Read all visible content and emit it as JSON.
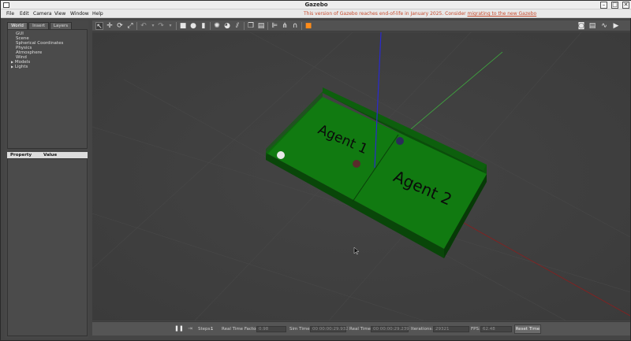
{
  "window": {
    "title": "Gazebo",
    "minimize_glyph": "–",
    "maximize_glyph": "□",
    "close_glyph": "✕"
  },
  "menubar": {
    "items": [
      "File",
      "Edit",
      "Camera",
      "View",
      "Window",
      "Help"
    ],
    "notice_prefix": "This version of Gazebo reaches end-of-life in January 2025. Consider",
    "notice_link": "migrating to the new Gazebo"
  },
  "left_panel": {
    "tabs": [
      "World",
      "Insert",
      "Layers"
    ],
    "active_tab": "World",
    "tree": [
      {
        "label": "GUI",
        "expandable": false
      },
      {
        "label": "Scene",
        "expandable": false
      },
      {
        "label": "Spherical Coordinates",
        "expandable": false
      },
      {
        "label": "Physics",
        "expandable": false
      },
      {
        "label": "Atmosphere",
        "expandable": false
      },
      {
        "label": "Wind",
        "expandable": false
      },
      {
        "label": "Models",
        "expandable": true
      },
      {
        "label": "Lights",
        "expandable": true
      }
    ],
    "property_header": {
      "property": "Property",
      "value": "Value"
    }
  },
  "toolbar": {
    "icons": [
      "select-mode-icon",
      "translate-mode-icon",
      "rotate-mode-icon",
      "scale-mode-icon",
      "undo-icon",
      "undo-history-icon",
      "redo-icon",
      "redo-history-icon",
      "box-icon",
      "sphere-icon",
      "cylinder-icon",
      "point-light-icon",
      "spot-light-icon",
      "directional-light-icon",
      "copy-icon",
      "paste-icon",
      "align-icon",
      "snap-icon",
      "view-angle-icon",
      "record-icon"
    ],
    "right_icons": [
      "screenshot-icon",
      "log-icon",
      "plot-icon",
      "video-icon"
    ],
    "accent_color": "#ff8c1a"
  },
  "scene": {
    "labels": [
      "Agent 1",
      "Agent 2"
    ],
    "ground_color": "#0f6e0f",
    "wall_color": "#0c560c",
    "axis_colors": {
      "x": "#8a1e1e",
      "y": "#3fae3f",
      "z": "#2a2acf"
    }
  },
  "bottombar": {
    "pause_glyph": "❚❚",
    "step_glyph": "⇥",
    "steps_label": "Steps:",
    "steps_value": "1",
    "real_time_factor_label": "Real Time Factor:",
    "real_time_factor_value": "0.98",
    "sim_time_label": "Sim Time:",
    "sim_time_value": "00 00:00:29.932",
    "real_time_label": "Real Time:",
    "real_time_value": "00 00:00:29.239",
    "iterations_label": "Iterations:",
    "iterations_value": "29321",
    "fps_label": "FPS:",
    "fps_value": "62.48",
    "reset_time_label": "Reset Time"
  }
}
